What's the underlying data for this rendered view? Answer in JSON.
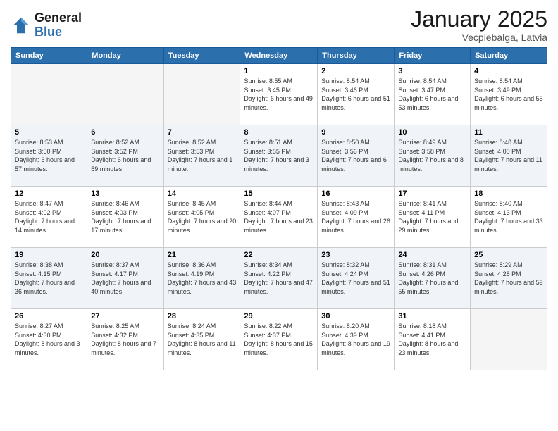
{
  "header": {
    "logo_general": "General",
    "logo_blue": "Blue",
    "month": "January 2025",
    "location": "Vecpiebalga, Latvia"
  },
  "days_of_week": [
    "Sunday",
    "Monday",
    "Tuesday",
    "Wednesday",
    "Thursday",
    "Friday",
    "Saturday"
  ],
  "weeks": [
    [
      {
        "num": "",
        "info": ""
      },
      {
        "num": "",
        "info": ""
      },
      {
        "num": "",
        "info": ""
      },
      {
        "num": "1",
        "info": "Sunrise: 8:55 AM\nSunset: 3:45 PM\nDaylight: 6 hours\nand 49 minutes."
      },
      {
        "num": "2",
        "info": "Sunrise: 8:54 AM\nSunset: 3:46 PM\nDaylight: 6 hours\nand 51 minutes."
      },
      {
        "num": "3",
        "info": "Sunrise: 8:54 AM\nSunset: 3:47 PM\nDaylight: 6 hours\nand 53 minutes."
      },
      {
        "num": "4",
        "info": "Sunrise: 8:54 AM\nSunset: 3:49 PM\nDaylight: 6 hours\nand 55 minutes."
      }
    ],
    [
      {
        "num": "5",
        "info": "Sunrise: 8:53 AM\nSunset: 3:50 PM\nDaylight: 6 hours\nand 57 minutes."
      },
      {
        "num": "6",
        "info": "Sunrise: 8:52 AM\nSunset: 3:52 PM\nDaylight: 6 hours\nand 59 minutes."
      },
      {
        "num": "7",
        "info": "Sunrise: 8:52 AM\nSunset: 3:53 PM\nDaylight: 7 hours\nand 1 minute."
      },
      {
        "num": "8",
        "info": "Sunrise: 8:51 AM\nSunset: 3:55 PM\nDaylight: 7 hours\nand 3 minutes."
      },
      {
        "num": "9",
        "info": "Sunrise: 8:50 AM\nSunset: 3:56 PM\nDaylight: 7 hours\nand 6 minutes."
      },
      {
        "num": "10",
        "info": "Sunrise: 8:49 AM\nSunset: 3:58 PM\nDaylight: 7 hours\nand 8 minutes."
      },
      {
        "num": "11",
        "info": "Sunrise: 8:48 AM\nSunset: 4:00 PM\nDaylight: 7 hours\nand 11 minutes."
      }
    ],
    [
      {
        "num": "12",
        "info": "Sunrise: 8:47 AM\nSunset: 4:02 PM\nDaylight: 7 hours\nand 14 minutes."
      },
      {
        "num": "13",
        "info": "Sunrise: 8:46 AM\nSunset: 4:03 PM\nDaylight: 7 hours\nand 17 minutes."
      },
      {
        "num": "14",
        "info": "Sunrise: 8:45 AM\nSunset: 4:05 PM\nDaylight: 7 hours\nand 20 minutes."
      },
      {
        "num": "15",
        "info": "Sunrise: 8:44 AM\nSunset: 4:07 PM\nDaylight: 7 hours\nand 23 minutes."
      },
      {
        "num": "16",
        "info": "Sunrise: 8:43 AM\nSunset: 4:09 PM\nDaylight: 7 hours\nand 26 minutes."
      },
      {
        "num": "17",
        "info": "Sunrise: 8:41 AM\nSunset: 4:11 PM\nDaylight: 7 hours\nand 29 minutes."
      },
      {
        "num": "18",
        "info": "Sunrise: 8:40 AM\nSunset: 4:13 PM\nDaylight: 7 hours\nand 33 minutes."
      }
    ],
    [
      {
        "num": "19",
        "info": "Sunrise: 8:38 AM\nSunset: 4:15 PM\nDaylight: 7 hours\nand 36 minutes."
      },
      {
        "num": "20",
        "info": "Sunrise: 8:37 AM\nSunset: 4:17 PM\nDaylight: 7 hours\nand 40 minutes."
      },
      {
        "num": "21",
        "info": "Sunrise: 8:36 AM\nSunset: 4:19 PM\nDaylight: 7 hours\nand 43 minutes."
      },
      {
        "num": "22",
        "info": "Sunrise: 8:34 AM\nSunset: 4:22 PM\nDaylight: 7 hours\nand 47 minutes."
      },
      {
        "num": "23",
        "info": "Sunrise: 8:32 AM\nSunset: 4:24 PM\nDaylight: 7 hours\nand 51 minutes."
      },
      {
        "num": "24",
        "info": "Sunrise: 8:31 AM\nSunset: 4:26 PM\nDaylight: 7 hours\nand 55 minutes."
      },
      {
        "num": "25",
        "info": "Sunrise: 8:29 AM\nSunset: 4:28 PM\nDaylight: 7 hours\nand 59 minutes."
      }
    ],
    [
      {
        "num": "26",
        "info": "Sunrise: 8:27 AM\nSunset: 4:30 PM\nDaylight: 8 hours\nand 3 minutes."
      },
      {
        "num": "27",
        "info": "Sunrise: 8:25 AM\nSunset: 4:32 PM\nDaylight: 8 hours\nand 7 minutes."
      },
      {
        "num": "28",
        "info": "Sunrise: 8:24 AM\nSunset: 4:35 PM\nDaylight: 8 hours\nand 11 minutes."
      },
      {
        "num": "29",
        "info": "Sunrise: 8:22 AM\nSunset: 4:37 PM\nDaylight: 8 hours\nand 15 minutes."
      },
      {
        "num": "30",
        "info": "Sunrise: 8:20 AM\nSunset: 4:39 PM\nDaylight: 8 hours\nand 19 minutes."
      },
      {
        "num": "31",
        "info": "Sunrise: 8:18 AM\nSunset: 4:41 PM\nDaylight: 8 hours\nand 23 minutes."
      },
      {
        "num": "",
        "info": ""
      }
    ]
  ]
}
